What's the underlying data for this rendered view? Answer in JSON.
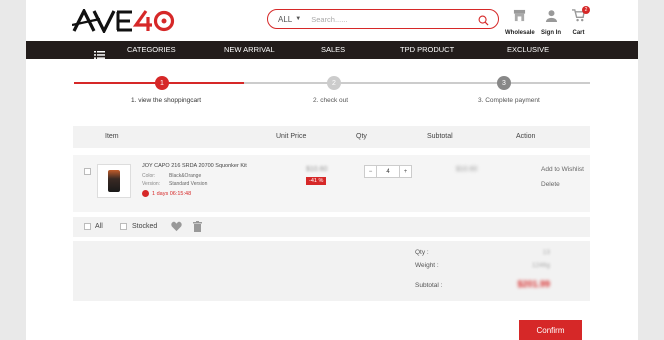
{
  "logo": {
    "text": "AVE40"
  },
  "search": {
    "scope": "ALL",
    "placeholder": "Search......"
  },
  "header_icons": {
    "wholesale": "Wholesale",
    "signin": "Sign In",
    "cart": "Cart",
    "cart_count": "2"
  },
  "nav": {
    "items": [
      "CATEGORIES",
      "NEW ARRIVAL",
      "SALES",
      "TPD PRODUCT",
      "EXCLUSIVE"
    ]
  },
  "steps": [
    {
      "num": "1",
      "label": "1. view the shoppingcart",
      "active": true
    },
    {
      "num": "2",
      "label": "2. check out",
      "active": false
    },
    {
      "num": "3",
      "label": "3. Complete payment",
      "active": false
    }
  ],
  "table": {
    "headers": {
      "item": "Item",
      "unit_price": "Unit Price",
      "qty": "Qty",
      "subtotal": "Subtotal",
      "action": "Action"
    }
  },
  "cart_item": {
    "name": "JOY CAPO 216 SRDA 20700 Squonker Kit",
    "color_label": "Color:",
    "color": "Black&Orange",
    "version_label": "Version:",
    "version": "Standard Version",
    "timer": "1 days  06:15:48",
    "price_old": "$10.60",
    "discount": "-41 %",
    "qty": "4",
    "subtotal": "$10.60",
    "add_wishlist": "Add to Wishlist",
    "delete": "Delete"
  },
  "footer_bar": {
    "all": "All",
    "stocked": "Stocked"
  },
  "summary": {
    "qty_label": "Qty :",
    "qty_value": "13",
    "weight_label": "Weight :",
    "weight_value": "1246g",
    "subtotal_label": "Subtotal :",
    "subtotal_value": "$201.99"
  },
  "confirm": "Confirm",
  "colors": {
    "accent": "#d62828",
    "nav_bg": "#221c1b",
    "step_inactive": "#999999"
  }
}
